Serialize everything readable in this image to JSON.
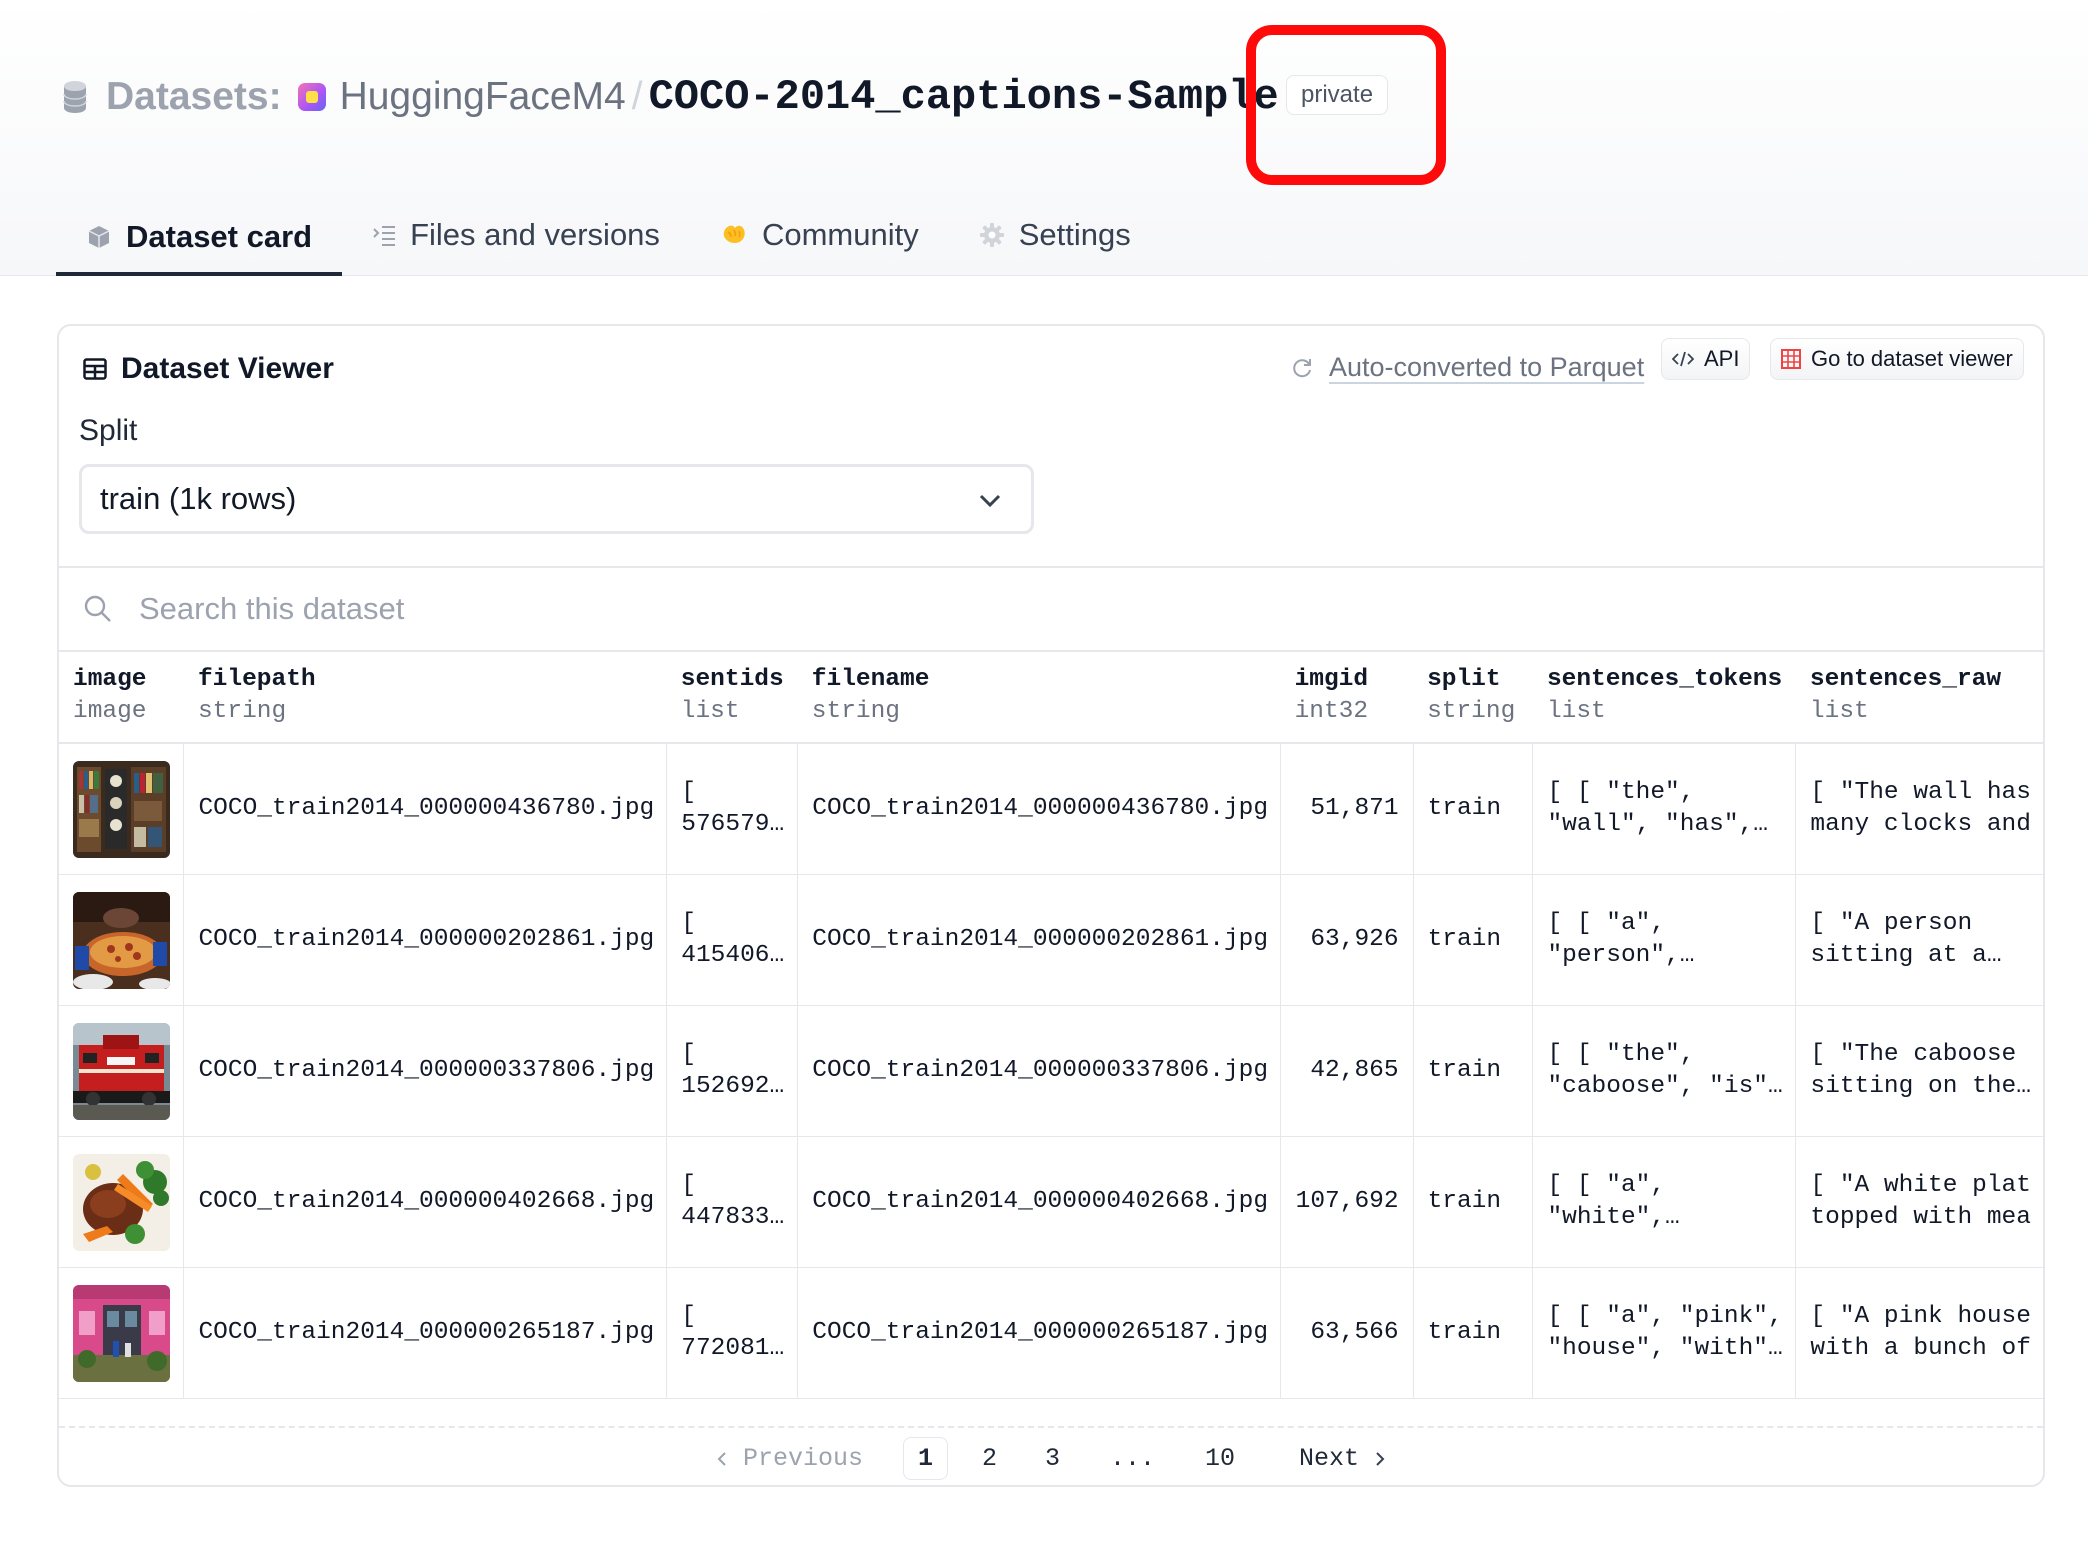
{
  "header": {
    "section_label": "Datasets:",
    "org": "HuggingFaceM4",
    "separator": "/",
    "repo": "COCO-2014_captions-Sample",
    "visibility_badge": "private"
  },
  "tabs": [
    {
      "label": "Dataset card",
      "icon": "dataset-card-icon",
      "active": true
    },
    {
      "label": "Files and versions",
      "icon": "files-icon",
      "active": false
    },
    {
      "label": "Community",
      "icon": "community-icon",
      "active": false
    },
    {
      "label": "Settings",
      "icon": "gear-icon",
      "active": false
    }
  ],
  "viewer": {
    "title": "Dataset Viewer",
    "parquet_link": "Auto-converted to Parquet",
    "api_button": "API",
    "goto_button": "Go to dataset viewer",
    "split_label": "Split",
    "split_value": "train (1k rows)",
    "search_placeholder": "Search this dataset"
  },
  "columns": [
    {
      "name": "image",
      "type": "image"
    },
    {
      "name": "filepath",
      "type": "string"
    },
    {
      "name": "sentids",
      "type": "list"
    },
    {
      "name": "filename",
      "type": "string"
    },
    {
      "name": "imgid",
      "type": "int32"
    },
    {
      "name": "split",
      "type": "string"
    },
    {
      "name": "sentences_tokens",
      "type": "list"
    },
    {
      "name": "sentences_raw",
      "type": "list"
    }
  ],
  "rows": [
    {
      "filepath": "COCO_train2014_000000436780.jpg",
      "sentids_1": "[",
      "sentids_2": "576579…",
      "filename": "COCO_train2014_000000436780.jpg",
      "imgid": "51,871",
      "split": "train",
      "tokens_1": "[ [ \"the\",",
      "tokens_2": "\"wall\", \"has\",…",
      "raw_1": "[ \"The wall has",
      "raw_2": "many clocks and"
    },
    {
      "filepath": "COCO_train2014_000000202861.jpg",
      "sentids_1": "[",
      "sentids_2": "415406…",
      "filename": "COCO_train2014_000000202861.jpg",
      "imgid": "63,926",
      "split": "train",
      "tokens_1": "[ [ \"a\",",
      "tokens_2": "\"person\",…",
      "raw_1": "[ \"A person",
      "raw_2": "sitting at a…"
    },
    {
      "filepath": "COCO_train2014_000000337806.jpg",
      "sentids_1": "[",
      "sentids_2": "152692…",
      "filename": "COCO_train2014_000000337806.jpg",
      "imgid": "42,865",
      "split": "train",
      "tokens_1": "[ [ \"the\",",
      "tokens_2": "\"caboose\", \"is\"…",
      "raw_1": "[ \"The caboose",
      "raw_2": "sitting on the…"
    },
    {
      "filepath": "COCO_train2014_000000402668.jpg",
      "sentids_1": "[",
      "sentids_2": "447833…",
      "filename": "COCO_train2014_000000402668.jpg",
      "imgid": "107,692",
      "split": "train",
      "tokens_1": "[ [ \"a\",",
      "tokens_2": "\"white\",…",
      "raw_1": "[ \"A white plat",
      "raw_2": "topped with mea"
    },
    {
      "filepath": "COCO_train2014_000000265187.jpg",
      "sentids_1": "[",
      "sentids_2": "772081…",
      "filename": "COCO_train2014_000000265187.jpg",
      "imgid": "63,566",
      "split": "train",
      "tokens_1": "[ [ \"a\", \"pink\",",
      "tokens_2": "\"house\", \"with\"…",
      "raw_1": "[ \"A pink house",
      "raw_2": "with a bunch of"
    }
  ],
  "pagination": {
    "previous": "Previous",
    "pages": [
      "1",
      "2",
      "3"
    ],
    "ellipsis": "...",
    "last_page": "10",
    "next": "Next",
    "current": "1"
  },
  "colors": {
    "highlight": "#ff0a0a",
    "text": "#111827",
    "muted": "#6b7280",
    "border": "#e5e7eb"
  }
}
